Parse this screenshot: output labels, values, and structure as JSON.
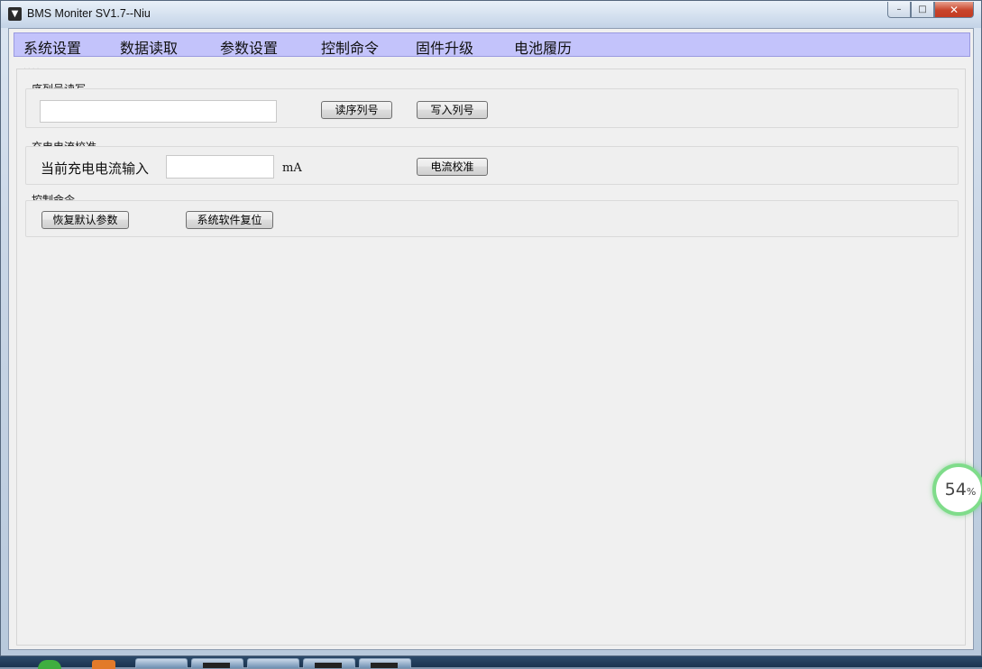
{
  "window": {
    "title": "BMS Moniter SV1.7--Niu",
    "app_icon_glyph": "▼",
    "controls": {
      "minimize": "–",
      "maximize": "□",
      "close": "✕"
    }
  },
  "menu": {
    "items": [
      {
        "label": "系统设置"
      },
      {
        "label": "数据读取"
      },
      {
        "label": "参数设置"
      },
      {
        "label": "控制命令"
      },
      {
        "label": "固件升级"
      },
      {
        "label": "电池履历"
      }
    ]
  },
  "tab_indicator": "....",
  "serial_group": {
    "title": "序列号读写",
    "serial_value": "",
    "read_button": "读序列号",
    "write_button": "写入列号"
  },
  "current_group": {
    "title": "充电电流校准",
    "input_label": "当前充电电流输入",
    "input_value": "",
    "unit": "mA",
    "calibrate_button": "电流校准"
  },
  "control_group": {
    "title": "控制命令",
    "restore_button": "恢复默认参数",
    "reset_button": "系统软件复位"
  },
  "progress_widget": {
    "value": "54",
    "unit": "%",
    "accent_color": "#7fdc8a"
  },
  "colors": {
    "menubar": "#c3c3fb",
    "client_bg": "#f0f0f0",
    "close_button": "#c8432a"
  }
}
